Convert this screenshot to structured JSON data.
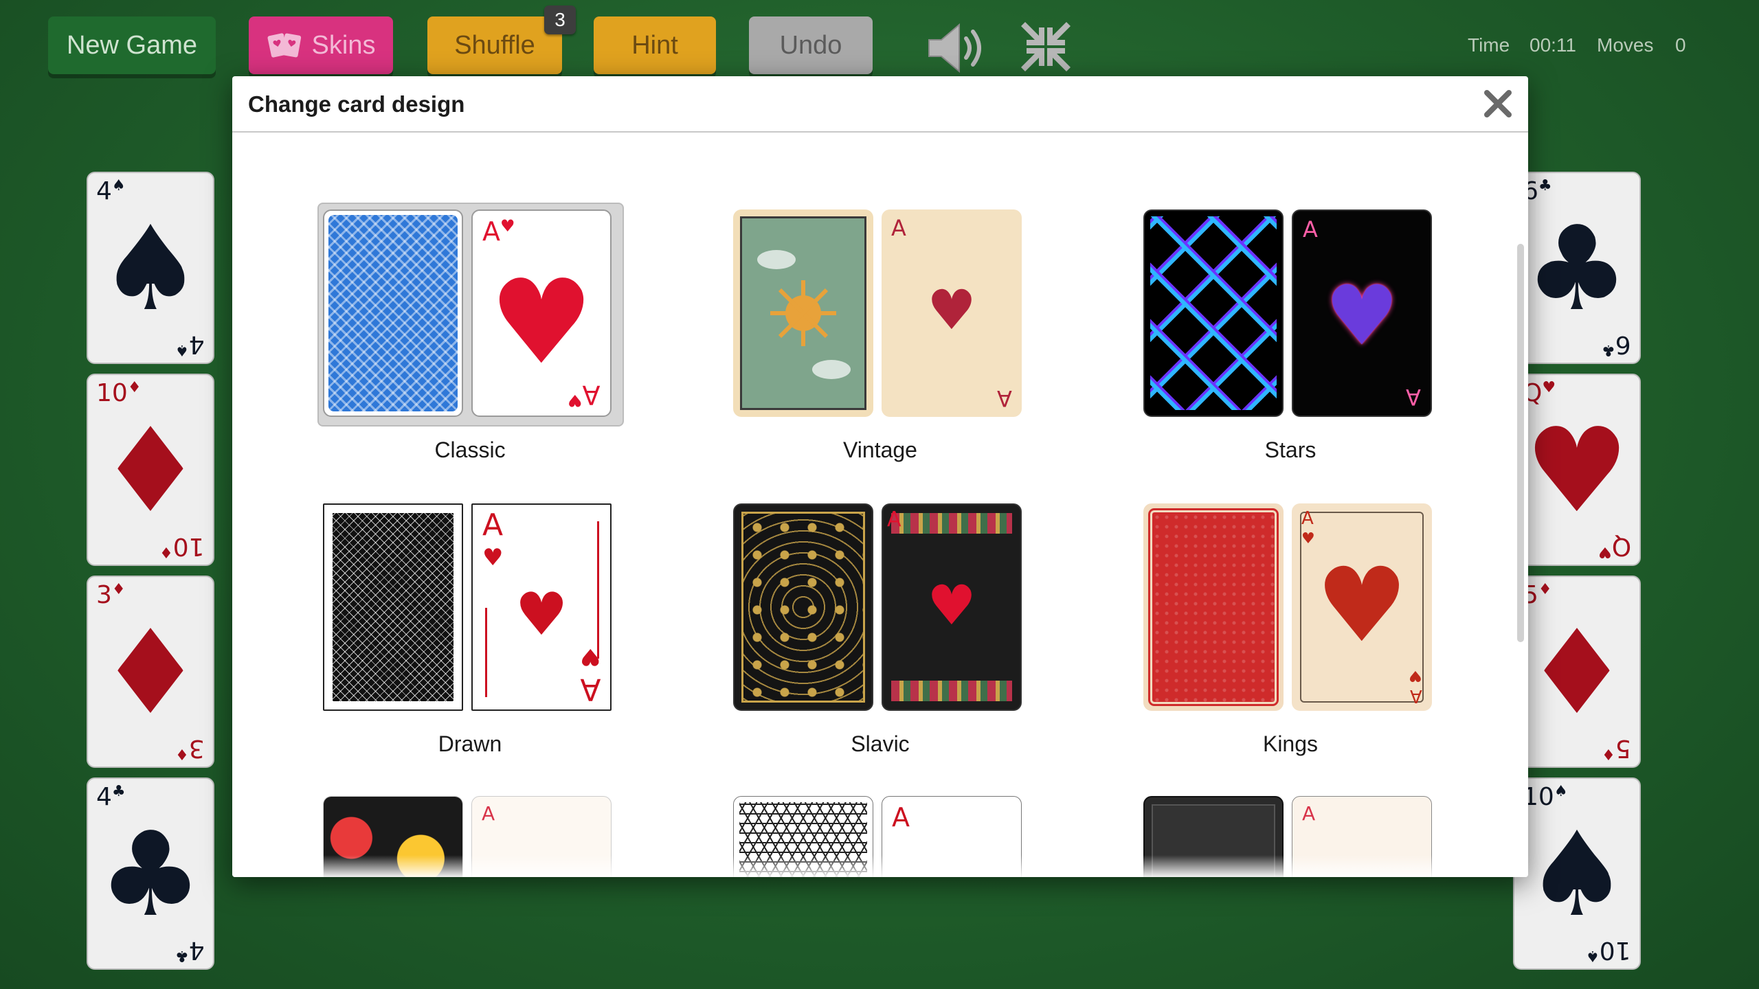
{
  "toolbar": {
    "new_game": "New Game",
    "skins": "Skins",
    "shuffle": "Shuffle",
    "shuffle_count": "3",
    "hint": "Hint",
    "undo": "Undo"
  },
  "stats": {
    "time_label": "Time",
    "time_value": "00:11",
    "moves_label": "Moves",
    "moves_value": "0"
  },
  "background_cards": {
    "left": [
      {
        "rank": "4",
        "suit": "♠",
        "color": "black"
      },
      {
        "rank": "10",
        "suit": "♦",
        "color": "red"
      },
      {
        "rank": "3",
        "suit": "♦",
        "color": "red"
      },
      {
        "rank": "4",
        "suit": "♣",
        "color": "black"
      }
    ],
    "right": [
      {
        "rank": "6",
        "suit": "♣",
        "color": "black"
      },
      {
        "rank": "Q",
        "suit": "♥",
        "color": "red"
      },
      {
        "rank": "5",
        "suit": "♦",
        "color": "red"
      },
      {
        "rank": "10",
        "suit": "♠",
        "color": "black"
      }
    ]
  },
  "modal": {
    "title": "Change card design",
    "designs": [
      {
        "name": "Classic",
        "selected": true
      },
      {
        "name": "Vintage",
        "selected": false
      },
      {
        "name": "Stars",
        "selected": false
      },
      {
        "name": "Drawn",
        "selected": false
      },
      {
        "name": "Slavic",
        "selected": false
      },
      {
        "name": "Kings",
        "selected": false
      }
    ],
    "face_rank": "A",
    "face_suit": "♥"
  },
  "colors": {
    "table_green": "#1f5d2a",
    "new_game_btn": "#1f6a2e",
    "skins_btn": "#d8327f",
    "shuffle_btn": "#e0a21f",
    "undo_btn": "#a9a9a9",
    "heart_red": "#e0112f"
  }
}
